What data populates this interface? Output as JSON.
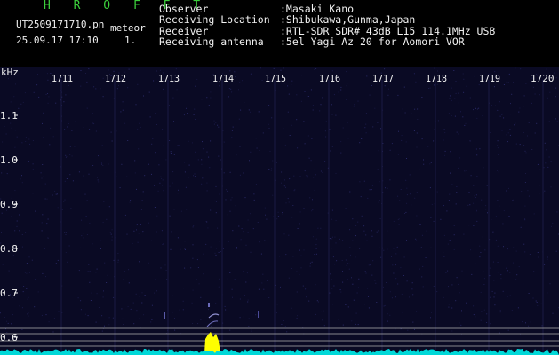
{
  "header": {
    "title": "H R O F F T",
    "filename": "UT2509171710.pn",
    "meteor_label": "meteor",
    "datetime": "25.09.17 17:10",
    "count": "1.",
    "info": [
      {
        "label": "Observer",
        "value": ":Masaki Kano"
      },
      {
        "label": "Receiving Location",
        "value": ":Shibukawa,Gunma,Japan"
      },
      {
        "label": "Receiver",
        "value": ":RTL-SDR SDR# 43dB L15 114.1MHz USB"
      },
      {
        "label": "Receiving antenna",
        "value": ":5el Yagi Az 20 for Aomori VOR"
      }
    ]
  },
  "plot": {
    "unit_label": "kHz",
    "x_ticks": [
      "1711",
      "1712",
      "1713",
      "1714",
      "1715",
      "1716",
      "1717",
      "1718",
      "1719",
      "1720"
    ],
    "y_ticks": [
      "1.1",
      "1.0",
      "0.9",
      "0.8",
      "0.7",
      "0.6"
    ],
    "colors": {
      "background": "#0a0a24",
      "text": "#f0f0f0",
      "title": "#3ccf3c",
      "meteor": "#ffff00",
      "noise": "#00d8d8",
      "guide": "#b0b0b0"
    }
  }
}
